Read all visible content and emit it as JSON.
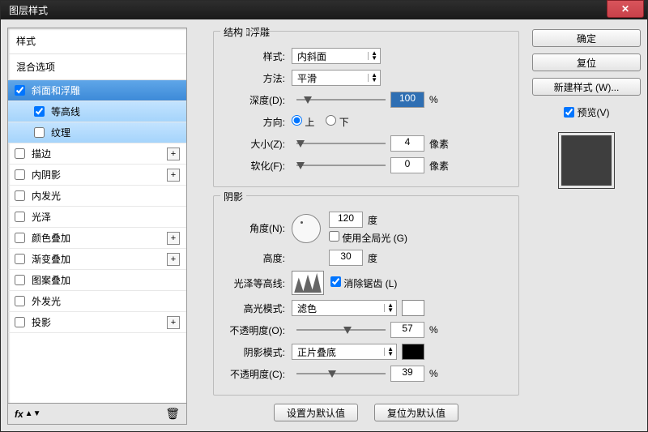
{
  "window": {
    "title": "图层样式"
  },
  "left": {
    "styles_header": "样式",
    "blend_header": "混合选项",
    "items": [
      {
        "label": "斜面和浮雕",
        "checked": true
      },
      {
        "label": "等高线",
        "checked": true
      },
      {
        "label": "纹理",
        "checked": false
      },
      {
        "label": "描边",
        "checked": false
      },
      {
        "label": "内阴影",
        "checked": false
      },
      {
        "label": "内发光",
        "checked": false
      },
      {
        "label": "光泽",
        "checked": false
      },
      {
        "label": "颜色叠加",
        "checked": false
      },
      {
        "label": "渐变叠加",
        "checked": false
      },
      {
        "label": "图案叠加",
        "checked": false
      },
      {
        "label": "外发光",
        "checked": false
      },
      {
        "label": "投影",
        "checked": false
      }
    ],
    "fx": "fx"
  },
  "mid": {
    "panel_title": "斜面和浮雕",
    "structure": {
      "legend": "结构",
      "style_label": "样式:",
      "style_value": "内斜面",
      "technique_label": "方法:",
      "technique_value": "平滑",
      "depth_label": "深度(D):",
      "depth_value": "100",
      "depth_unit": "%",
      "direction_label": "方向:",
      "direction_up": "上",
      "direction_down": "下",
      "size_label": "大小(Z):",
      "size_value": "4",
      "size_unit": "像素",
      "soften_label": "软化(F):",
      "soften_value": "0",
      "soften_unit": "像素"
    },
    "shading": {
      "legend": "阴影",
      "angle_label": "角度(N):",
      "angle_value": "120",
      "angle_unit": "度",
      "global_light": "使用全局光 (G)",
      "altitude_label": "高度:",
      "altitude_value": "30",
      "altitude_unit": "度",
      "gloss_label": "光泽等高线:",
      "antialias": "消除锯齿 (L)",
      "highlight_mode_label": "高光模式:",
      "highlight_mode_value": "滤色",
      "highlight_opacity_label": "不透明度(O):",
      "highlight_opacity_value": "57",
      "highlight_opacity_unit": "%",
      "shadow_mode_label": "阴影模式:",
      "shadow_mode_value": "正片叠底",
      "shadow_opacity_label": "不透明度(C):",
      "shadow_opacity_value": "39",
      "shadow_opacity_unit": "%"
    },
    "buttons": {
      "make_default": "设置为默认值",
      "reset_default": "复位为默认值"
    }
  },
  "right": {
    "ok": "确定",
    "cancel": "复位",
    "new_style": "新建样式 (W)...",
    "preview": "预览(V)"
  }
}
